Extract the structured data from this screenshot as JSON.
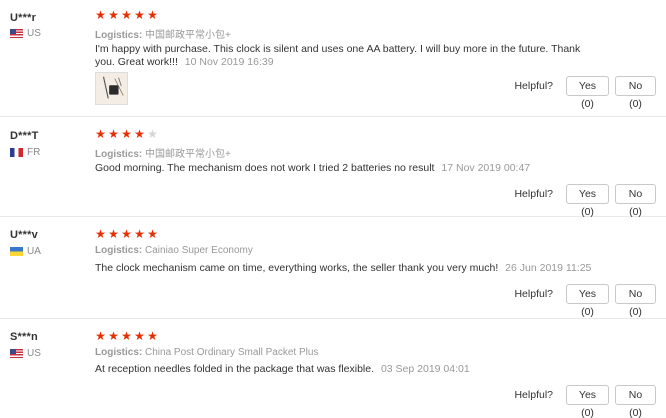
{
  "helpful_label": "Helpful?",
  "logistics_label": "Logistics:",
  "reviews": [
    {
      "user": "U***r",
      "country": "US",
      "rating": 5,
      "logistics": "中国邮政平常小包+",
      "text": "I'm happy with purchase. This clock is silent and uses one AA battery. I will buy more in the future. Thank you. Great work!!!",
      "date": "10 Nov 2019 16:39",
      "yes_label": "Yes (0)",
      "no_label": "No (0)"
    },
    {
      "user": "D***T",
      "country": "FR",
      "rating": 4,
      "logistics": "中国邮政平常小包+",
      "text": "Good morning. The mechanism does not work I tried 2 batteries no result",
      "date": "17 Nov 2019 00:47",
      "yes_label": "Yes (0)",
      "no_label": "No (0)"
    },
    {
      "user": "U***v",
      "country": "UA",
      "rating": 5,
      "logistics": "Cainiao Super Economy",
      "text": "The clock mechanism came on time, everything works, the seller thank you very much!",
      "date": "26 Jun 2019 11:25",
      "yes_label": "Yes (0)",
      "no_label": "No (0)"
    },
    {
      "user": "S***n",
      "country": "US",
      "rating": 5,
      "logistics": "China Post Ordinary Small Packet Plus",
      "text": "At reception needles folded in the package that was flexible.",
      "date": "03 Sep 2019 04:01",
      "yes_label": "Yes (0)",
      "no_label": "No (0)"
    }
  ],
  "colors": {
    "star_on": "#e62e04",
    "star_off": "#d6d6d6",
    "muted_text": "#999999",
    "divider": "#e8e8e8"
  }
}
